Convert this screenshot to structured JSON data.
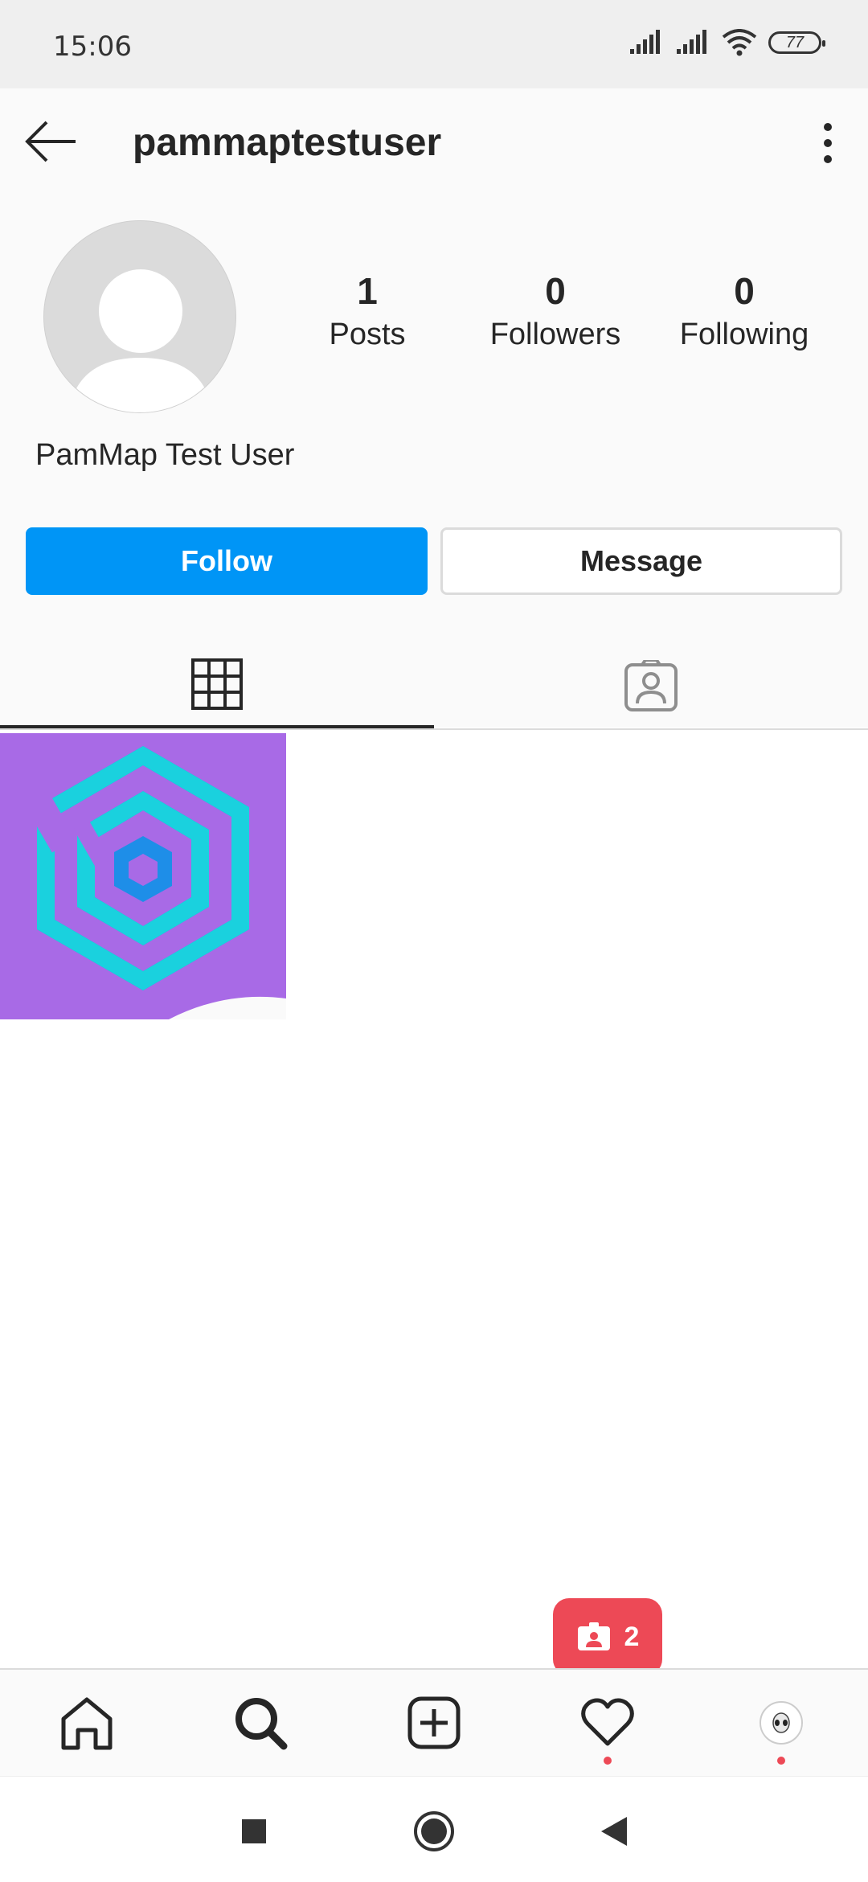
{
  "status_bar": {
    "time": "15:06",
    "battery": "77"
  },
  "header": {
    "username": "pammaptestuser"
  },
  "profile": {
    "full_name": "PamMap Test User",
    "stats": [
      {
        "value": "1",
        "label": "Posts"
      },
      {
        "value": "0",
        "label": "Followers"
      },
      {
        "value": "0",
        "label": "Following"
      }
    ]
  },
  "actions": {
    "follow_label": "Follow",
    "message_label": "Message"
  },
  "tabs": [
    {
      "icon": "grid-icon",
      "active": true
    },
    {
      "icon": "tagged-person-icon",
      "active": false
    }
  ],
  "notification": {
    "count": "2"
  },
  "bottom_nav": [
    "home-icon",
    "search-icon",
    "add-post-icon",
    "activity-heart-icon",
    "profile-avatar"
  ],
  "colors": {
    "follow_button": "#0095f6",
    "notification": "#ed4956",
    "post_background": "#a86ae6",
    "logo_cyan": "#1ad1de",
    "logo_blue": "#1e8ee8"
  }
}
